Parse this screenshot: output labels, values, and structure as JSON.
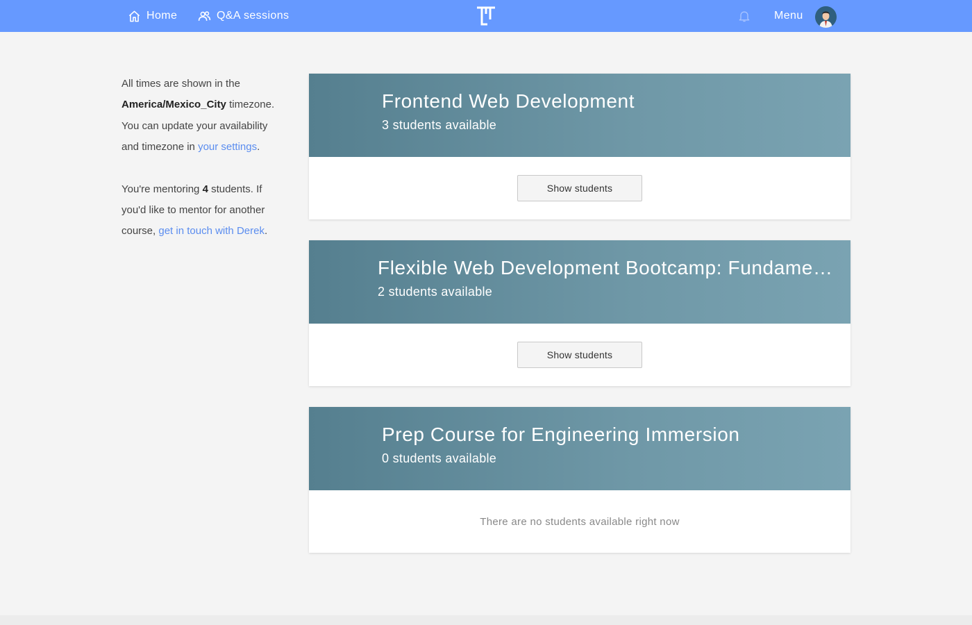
{
  "nav": {
    "home_label": "Home",
    "qa_label": "Q&A sessions",
    "menu_label": "Menu",
    "bar_color": "#6699ff"
  },
  "sidebar": {
    "p1_prefix": "All times are shown in the",
    "timezone": "America/Mexico_City",
    "p1_mid": "timezone. You can update your availability and timezone in",
    "settings_link": "your settings",
    "p1_end": ".",
    "p2_prefix": "You're mentoring",
    "student_count": "4",
    "p2_mid": "students. If you'd like to mentor for another course,",
    "contact_link": "get in touch with Derek",
    "p2_end": "."
  },
  "courses": [
    {
      "title": "Frontend Web Development",
      "availability": "3 students available",
      "button_label": "Show students"
    },
    {
      "title": "Flexible Web Development Bootcamp: Fundamentals",
      "availability": "2 students available",
      "button_label": "Show students"
    },
    {
      "title": "Prep Course for Engineering Immersion",
      "availability": "0 students available",
      "empty_message": "There are no students available right now"
    }
  ]
}
